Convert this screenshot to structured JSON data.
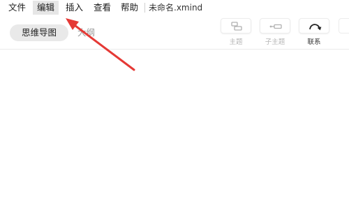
{
  "menubar": {
    "items": [
      {
        "label": "文件"
      },
      {
        "label": "编辑"
      },
      {
        "label": "插入"
      },
      {
        "label": "查看"
      },
      {
        "label": "帮助"
      }
    ],
    "file_name": "未命名.xmind"
  },
  "toolbar": {
    "views": [
      {
        "label": "思维导图",
        "active": true
      },
      {
        "label": "大纲",
        "active": false
      }
    ],
    "tools": [
      {
        "label": "主题",
        "icon": "topic-icon"
      },
      {
        "label": "子主题",
        "icon": "subtopic-icon"
      },
      {
        "label": "联系",
        "icon": "relationship-icon"
      }
    ]
  },
  "annotation": {
    "color": "#e53935",
    "points_to": "编辑"
  }
}
